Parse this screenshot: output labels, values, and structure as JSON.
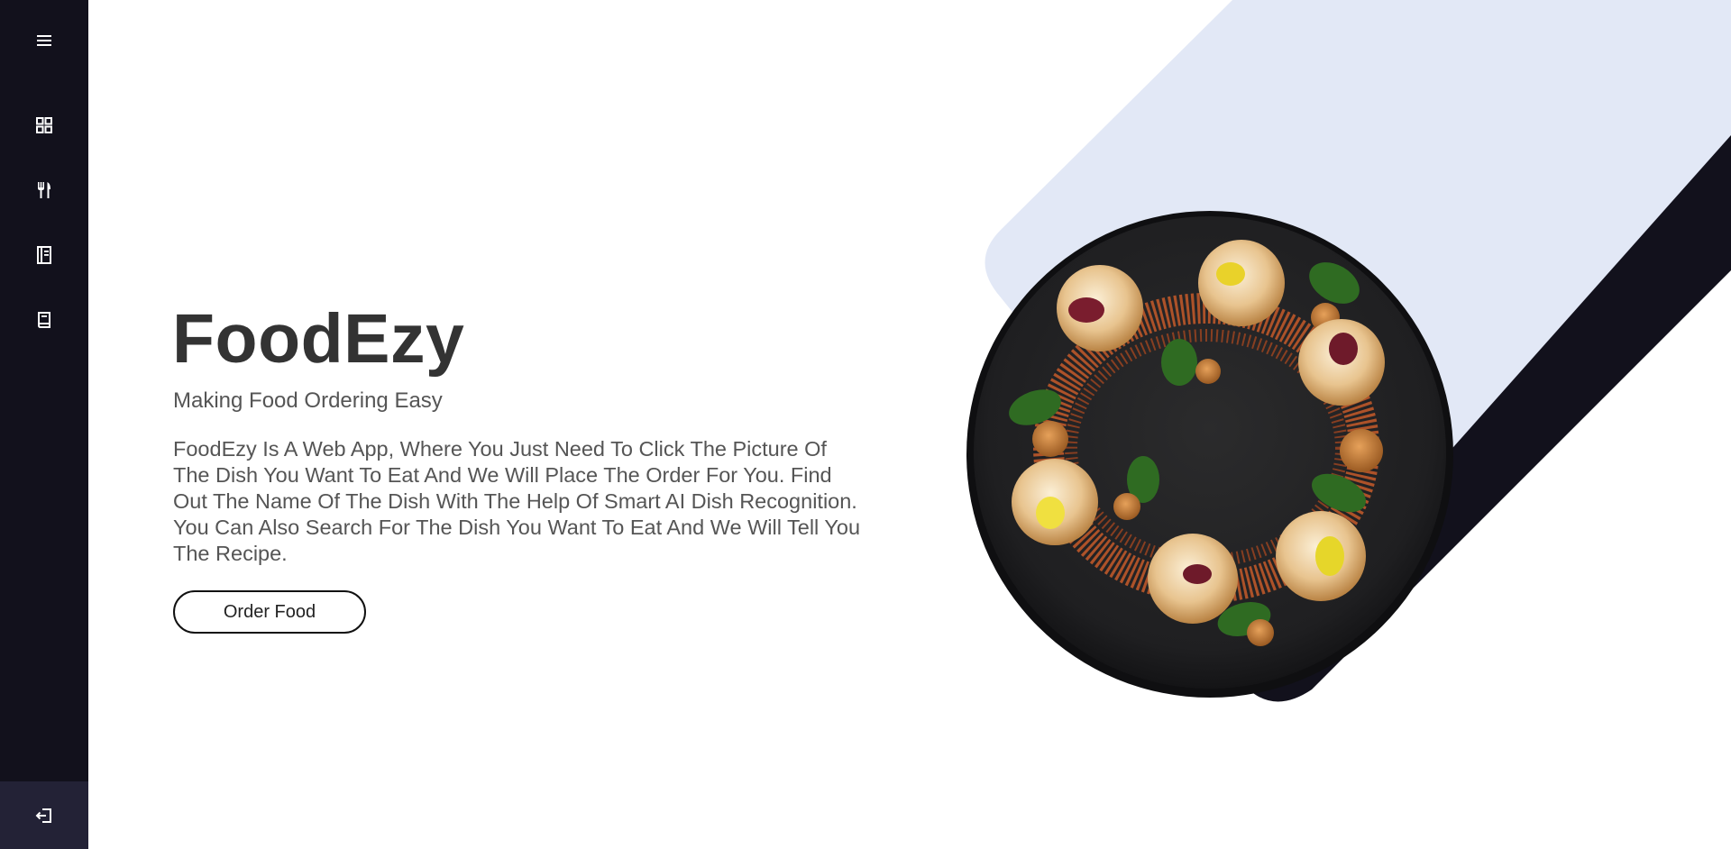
{
  "sidebar": {
    "items": [
      {
        "icon": "menu-icon"
      },
      {
        "icon": "dashboard-icon"
      },
      {
        "icon": "fork-knife-icon"
      },
      {
        "icon": "recipe-book-icon"
      },
      {
        "icon": "book-icon"
      }
    ],
    "logout_icon": "logout-icon"
  },
  "hero": {
    "title": "FoodEzy",
    "subtitle": "Making Food Ordering Easy",
    "description": "FoodEzy Is A Web App, Where You Just Need To Click The Picture Of The Dish You Want To Eat And We Will Place The Order For You. Find Out The Name Of The Dish With The Help Of Smart AI Dish Recognition. You Can Also Search For The Dish You Want To Eat And We Will Tell You The Recipe.",
    "button_label": "Order Food"
  },
  "colors": {
    "sidebar_bg": "#12111c",
    "accent_light": "#e2e8f6",
    "accent_dark": "#12111c",
    "text_dark": "#333333",
    "text_muted": "#555555"
  }
}
